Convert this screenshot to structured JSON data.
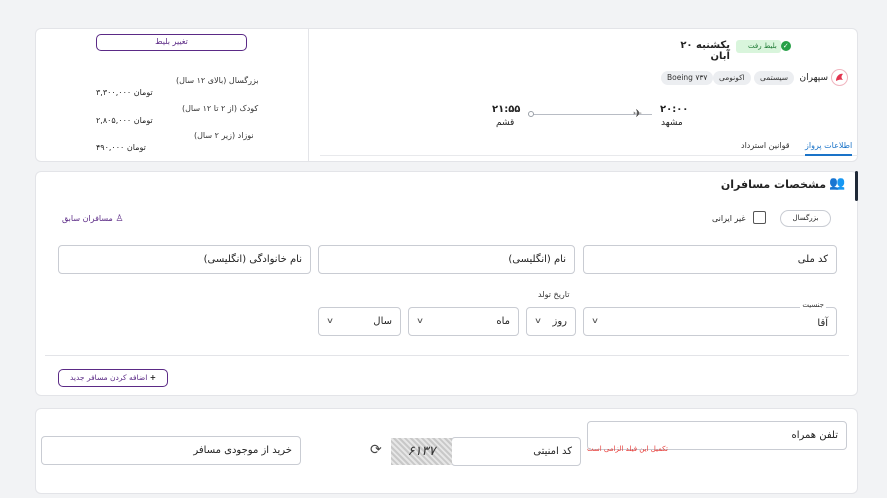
{
  "flight": {
    "badge": "بلیط رفت",
    "date": "یکشنبه ۲۰ آبان",
    "airline": "سپهران",
    "chips": [
      "سیستمی",
      "اکونومی",
      "Boeing ۷۳۷"
    ],
    "departure_time": "۲۰:۰۰",
    "departure_city": "مشهد",
    "arrival_time": "۲۱:۵۵",
    "arrival_city": "قشم",
    "tabs": [
      "اطلاعات پرواز",
      "قوانین استرداد"
    ]
  },
  "pricing": {
    "change_ticket": "تغییر بلیط",
    "rows": [
      {
        "label": "بزرگسال (بالای ۱۲ سال)",
        "price": "۳,۳۰۰,۰۰۰ تومان"
      },
      {
        "label": "کودک (از ۲ تا ۱۲ سال)",
        "price": "۲,۸۰۵,۰۰۰ تومان"
      },
      {
        "label": "نوزاد (زیر ۲ سال)",
        "price": "۴۹۰,۰۰۰ تومان"
      }
    ]
  },
  "passengers": {
    "title": "مشخصات مسافران",
    "previous_passengers": "مسافران سابق",
    "type_pill": "بزرگسال",
    "non_iranian": "غیر ایرانی",
    "national_code": "کد ملی",
    "first_name_en": "نام (انگلیسی)",
    "last_name_en": "نام خانوادگی (انگلیسی)",
    "gender_label": "جنسیت",
    "gender_value": "آقا",
    "birth_label": "تاریخ تولد",
    "day": "روز",
    "month": "ماه",
    "year": "سال",
    "add_passenger": "اضافه کردن مسافر جدید"
  },
  "contact": {
    "mobile": "تلفن همراه",
    "required_error": "تکمیل این فیلد الزامی است",
    "security_code": "کد امنیتی",
    "captcha": "۶۱۳۷",
    "wallet_purchase": "خرید از موجودی مسافر"
  },
  "colors": {
    "accent": "#5b2a86",
    "link": "#1a73c8",
    "error": "#e53935",
    "badge_bg": "#d9f5dc"
  }
}
